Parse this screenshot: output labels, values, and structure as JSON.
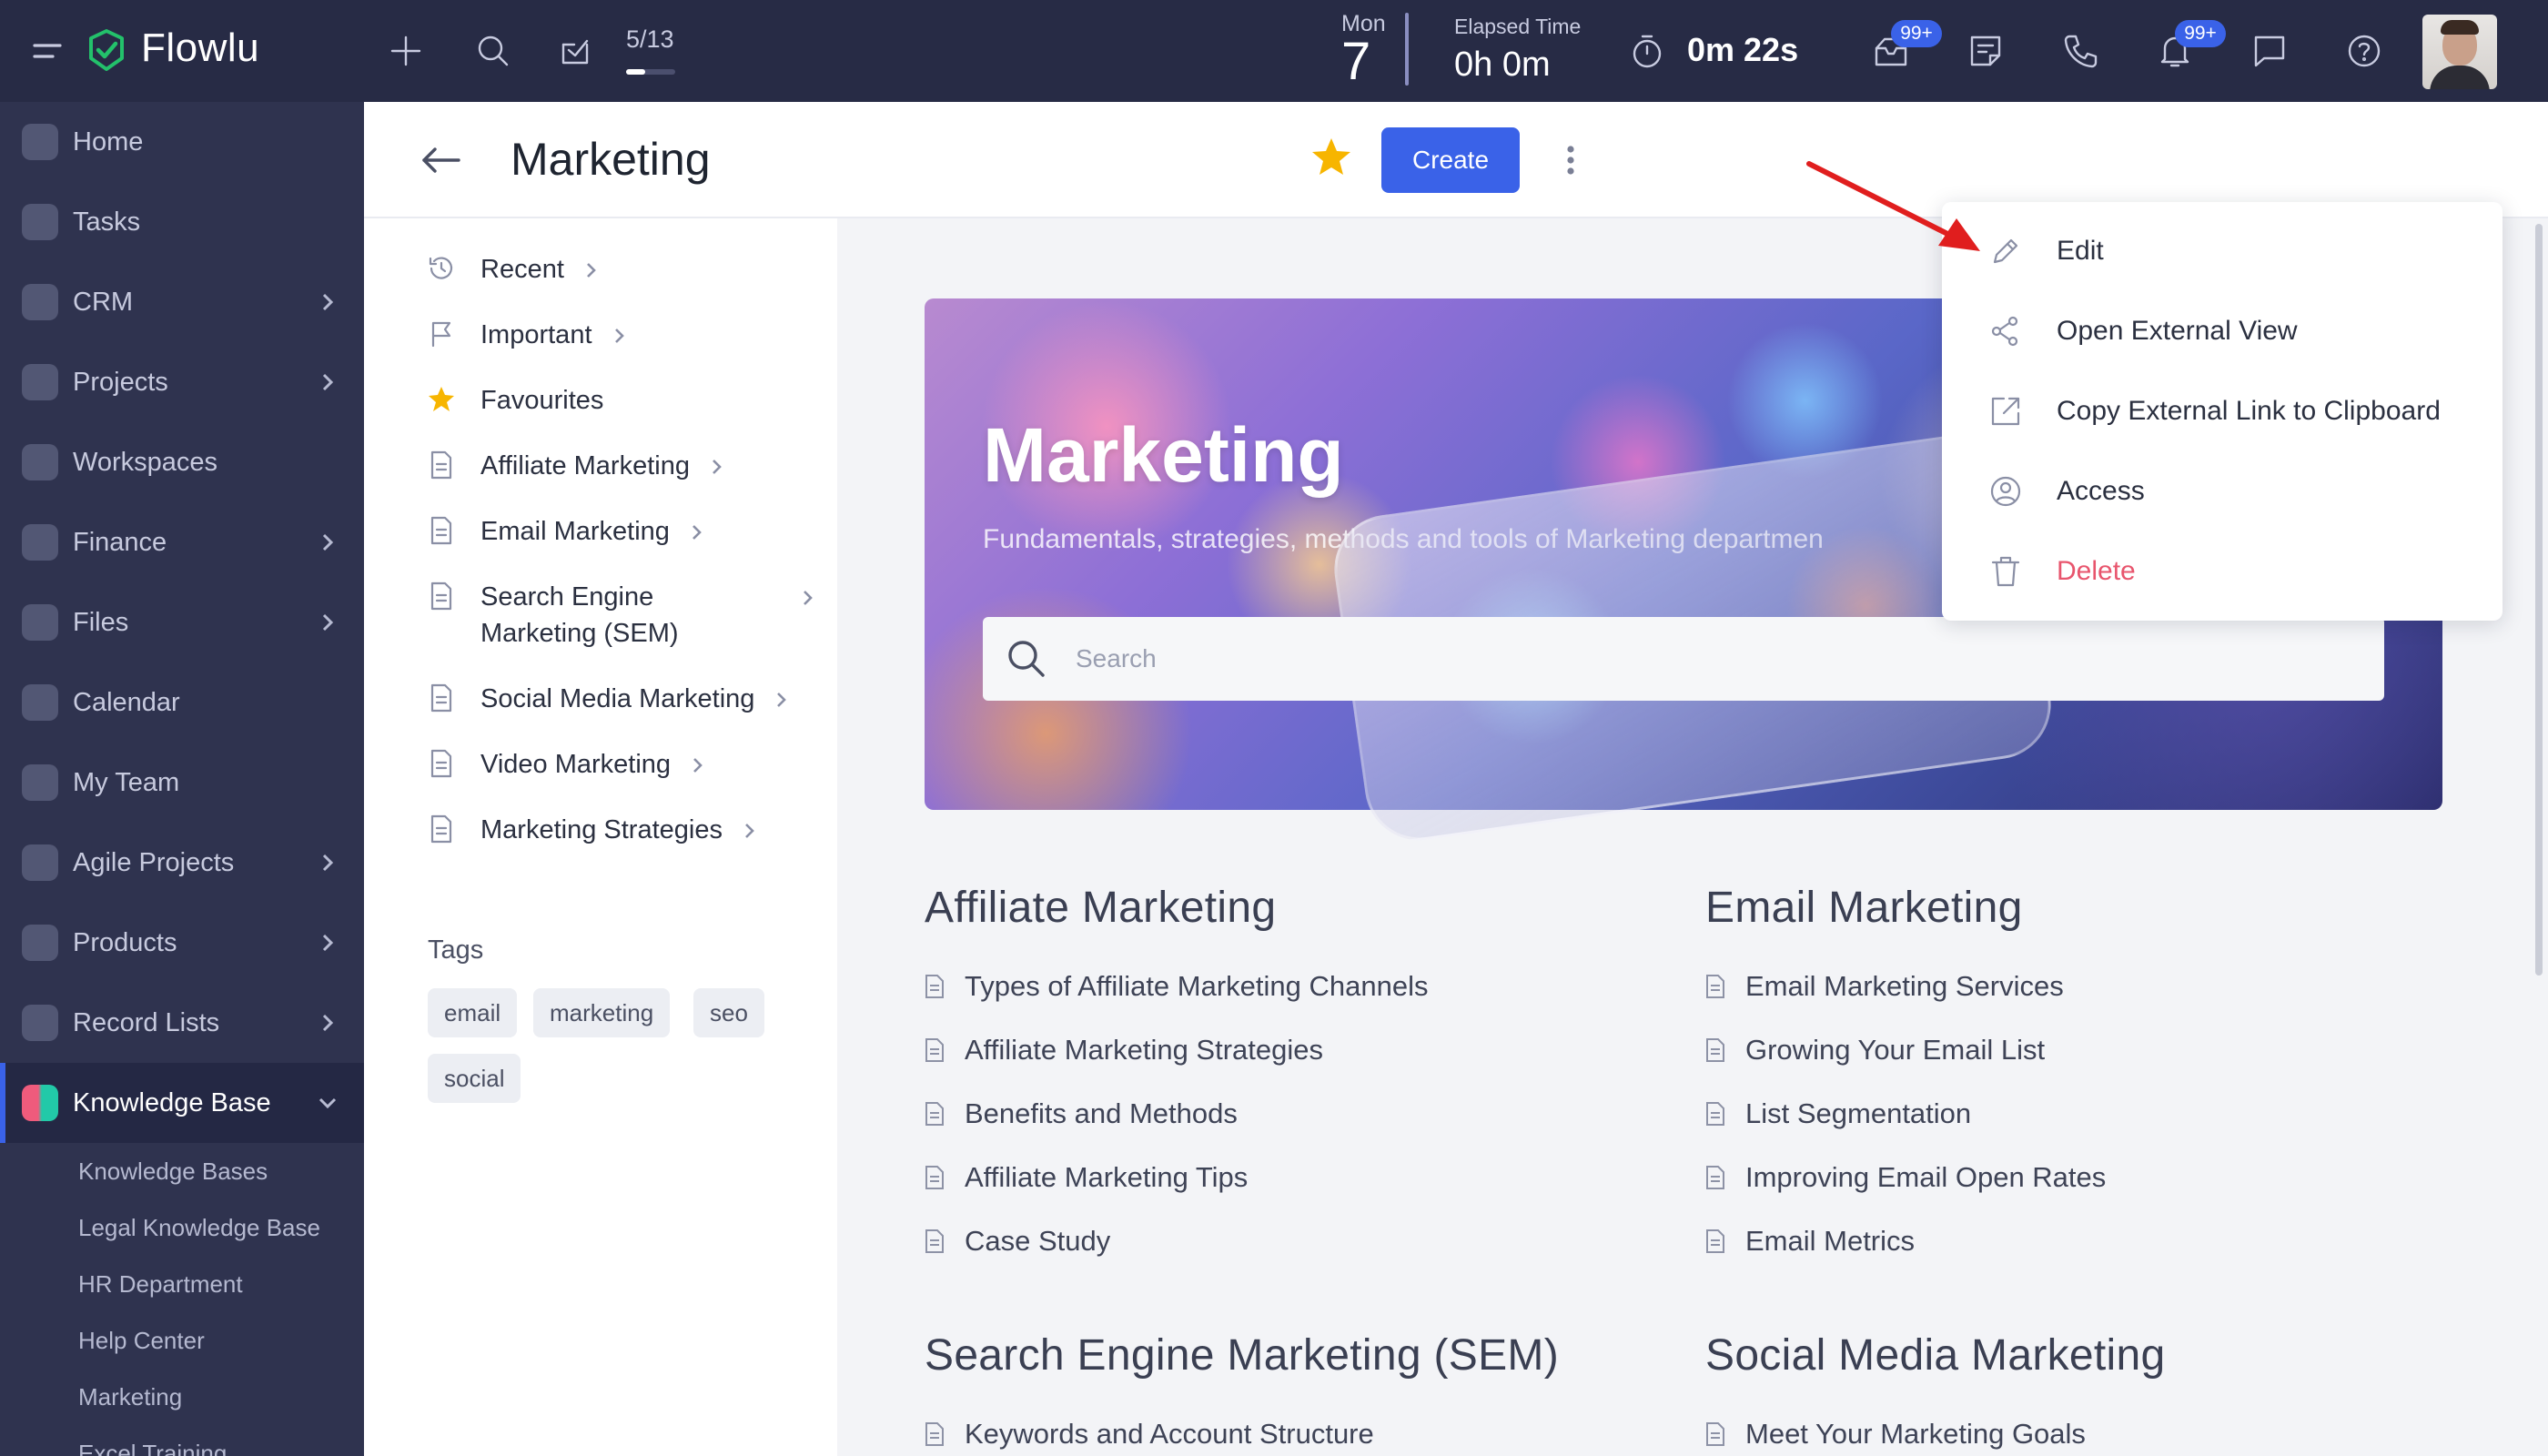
{
  "topbar": {
    "brand": "Flowlu",
    "counter": "5/13",
    "date_day": "Mon",
    "date_num": "7",
    "elapsed_label": "Elapsed Time",
    "elapsed_value": "0h 0m",
    "timer_value": "0m 22s",
    "mail_badge": "99+",
    "notif_badge": "99+"
  },
  "sidebar": {
    "items": [
      {
        "label": "Home"
      },
      {
        "label": "Tasks"
      },
      {
        "label": "CRM"
      },
      {
        "label": "Projects"
      },
      {
        "label": "Workspaces"
      },
      {
        "label": "Finance"
      },
      {
        "label": "Files"
      },
      {
        "label": "Calendar"
      },
      {
        "label": "My Team"
      },
      {
        "label": "Agile Projects"
      },
      {
        "label": "Products"
      },
      {
        "label": "Record Lists"
      },
      {
        "label": "Knowledge Base"
      }
    ],
    "sub_items": [
      {
        "label": "Knowledge Bases"
      },
      {
        "label": "Legal Knowledge Base"
      },
      {
        "label": "HR Department"
      },
      {
        "label": "Help Center"
      },
      {
        "label": "Marketing"
      },
      {
        "label": "Excel Training"
      }
    ]
  },
  "header": {
    "title": "Marketing",
    "create_label": "Create"
  },
  "leftpanel": {
    "items": [
      {
        "label": "Recent"
      },
      {
        "label": "Important"
      },
      {
        "label": "Favourites"
      },
      {
        "label": "Affiliate Marketing"
      },
      {
        "label": "Email Marketing"
      },
      {
        "label": "Search Engine"
      },
      {
        "label": "Marketing (SEM)"
      },
      {
        "label": "Social Media Marketing"
      },
      {
        "label": "Video Marketing"
      },
      {
        "label": "Marketing Strategies"
      }
    ],
    "tags_title": "Tags",
    "tags": [
      "email",
      "marketing",
      "seo",
      "social"
    ]
  },
  "banner": {
    "title": "Marketing",
    "subtitle": "Fundamentals, strategies, methods and tools of Marketing departmen",
    "search_placeholder": "Search"
  },
  "sections": [
    {
      "title": "Affiliate Marketing",
      "articles": [
        "Types of Affiliate Marketing Channels",
        "Affiliate Marketing Strategies",
        "Benefits and Methods",
        "Affiliate Marketing Tips",
        "Case Study"
      ]
    },
    {
      "title": "Email Marketing",
      "articles": [
        "Email Marketing Services",
        "Growing Your Email List",
        "List Segmentation",
        "Improving Email Open Rates",
        "Email Metrics"
      ]
    },
    {
      "title": "Search Engine Marketing (SEM)",
      "articles": [
        "Keywords and Account Structure"
      ]
    },
    {
      "title": "Social Media Marketing",
      "articles": [
        "Meet Your Marketing Goals"
      ]
    }
  ],
  "dropdown": {
    "items": [
      {
        "label": "Edit",
        "icon": "pencil-icon"
      },
      {
        "label": "Open External View",
        "icon": "share-icon"
      },
      {
        "label": "Copy External Link to Clipboard",
        "icon": "external-link-icon"
      },
      {
        "label": "Access",
        "icon": "user-circle-icon"
      },
      {
        "label": "Delete",
        "icon": "trash-icon"
      }
    ]
  },
  "colors": {
    "topbar": "#272b45",
    "sidebar": "#2f334f",
    "accent": "#3a62e8",
    "delete": "#e8556d",
    "star": "#f7b500",
    "annotation": "#e01e1e"
  }
}
